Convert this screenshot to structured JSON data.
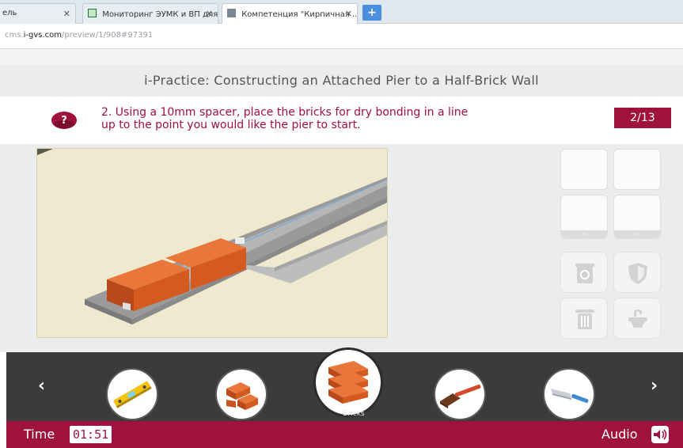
{
  "browser": {
    "tabs": [
      {
        "label": "ель",
        "close": "✕"
      },
      {
        "label": "Мониторинг ЭУМК и ВП для ...",
        "close": "✕"
      },
      {
        "label": "Компетенция \"Кирпичная ...",
        "close": "✕"
      }
    ],
    "new_tab": "+",
    "address": {
      "prefix": "cms.",
      "host": "i-gvs.com",
      "path": "/preview/1/908#97391"
    }
  },
  "lesson": {
    "title": "i-Practice: Constructing an Attached Pier to a Half-Brick Wall",
    "question": {
      "line1": "2. Using a 10mm spacer, place the bricks for dry bonding in a line",
      "line2": "up to the point you would like the pier to start.",
      "counter": "2/13"
    },
    "slots": {
      "prev_caption": "‹",
      "next_caption": "›"
    },
    "side_tools": [
      "recycle-icon",
      "shield-icon",
      "trash-icon",
      "tap-icon"
    ]
  },
  "toolbar": {
    "prev_arrow": "‹",
    "next_arrow": "›",
    "tools": [
      {
        "name": "spirit-level-icon"
      },
      {
        "name": "loose-bricks-icon"
      },
      {
        "name": "stacked-bricks-icon",
        "label": "Bricks",
        "selected": true
      },
      {
        "name": "brush-icon"
      },
      {
        "name": "trowel-icon"
      }
    ],
    "selected_label": "Bricks"
  },
  "status": {
    "time_label": "Time",
    "time_value": "01:51",
    "audio_label": "Audio"
  },
  "colors": {
    "accent": "#a0123e",
    "toolbar": "#3b3b3b",
    "brick": "#d9621c"
  }
}
